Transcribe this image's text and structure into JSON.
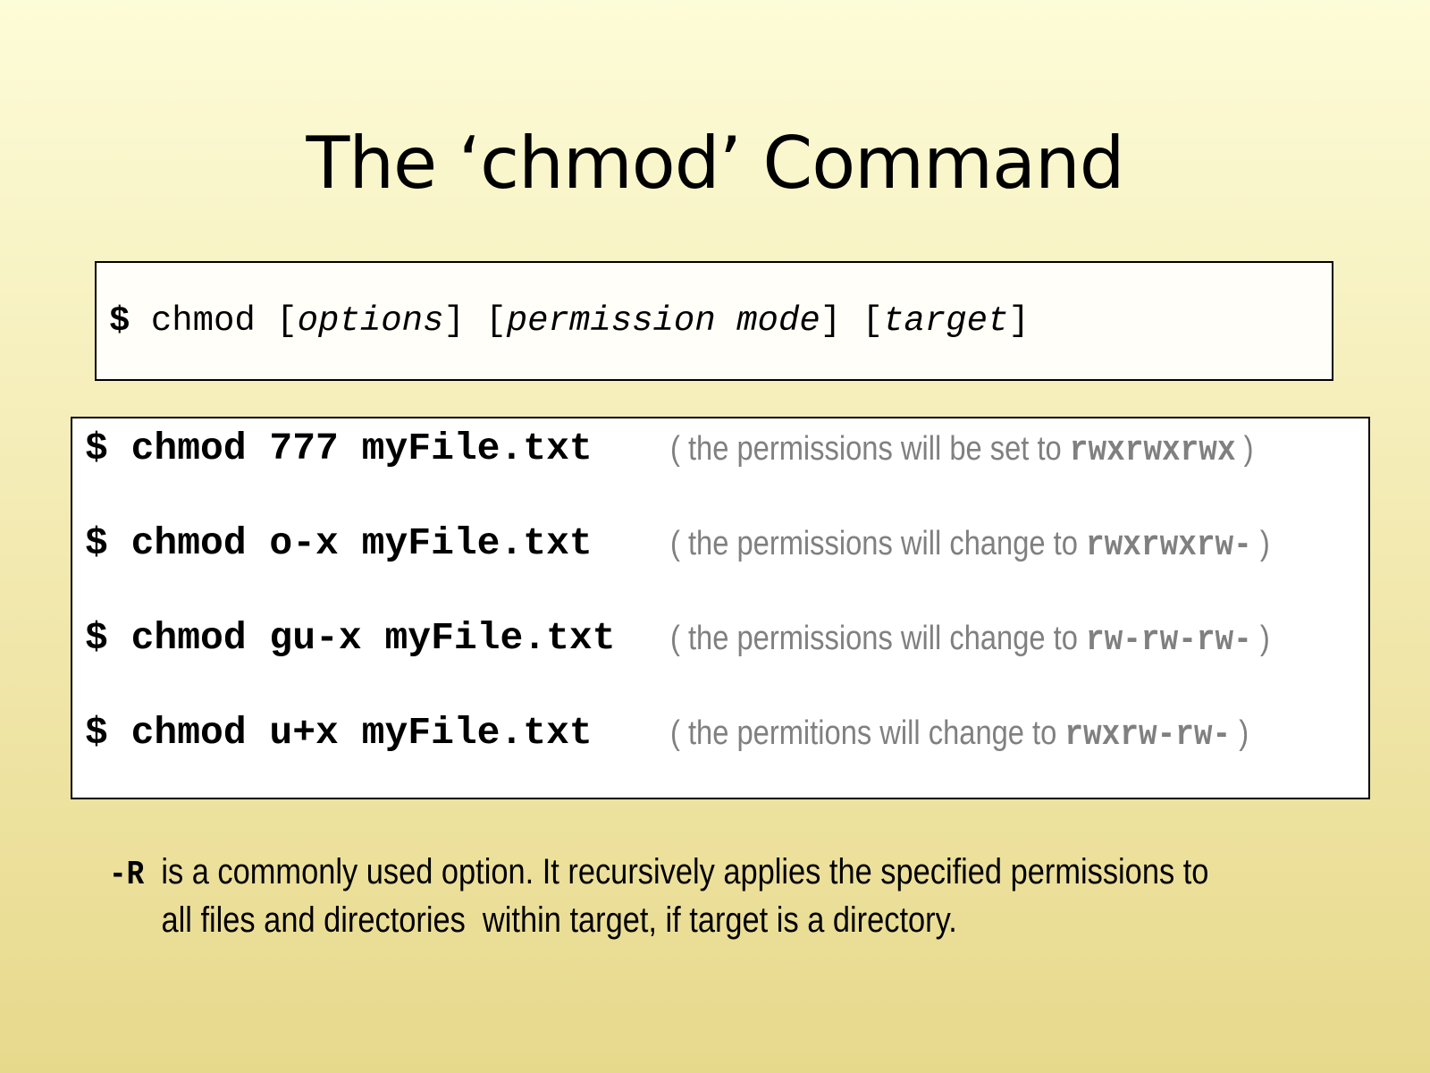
{
  "title": "The ‘chmod’ Command",
  "syntax": {
    "prompt": "$",
    "command": "chmod",
    "open1": "[",
    "arg1": "options",
    "close1": "]",
    "open2": "[",
    "arg2": "permission mode",
    "close2": "]",
    "open3": "[",
    "arg3": "target",
    "close3": "]"
  },
  "examples": [
    {
      "command": "$ chmod 777 myFile.txt",
      "note_prefix": "( the permissions will be set to ",
      "permissions": "rwxrwxrwx",
      "note_suffix": " )"
    },
    {
      "command": "$ chmod o-x myFile.txt",
      "note_prefix": "( the permissions will change to ",
      "permissions": "rwxrwxrw-",
      "note_suffix": " )"
    },
    {
      "command": "$ chmod gu-x myFile.txt",
      "note_prefix": "( the permissions will change to ",
      "permissions": "rw-rw-rw-",
      "note_suffix": " )"
    },
    {
      "command": "$ chmod u+x myFile.txt",
      "note_prefix": "( the permitions will change to ",
      "permissions": "rwxrw-rw-",
      "note_suffix": " )"
    }
  ],
  "footnote": {
    "flag": "-R",
    "line1": "  is a commonly used option. It recursively applies the specified permissions to",
    "line2": "all files and directories  within target, if target is a directory."
  }
}
